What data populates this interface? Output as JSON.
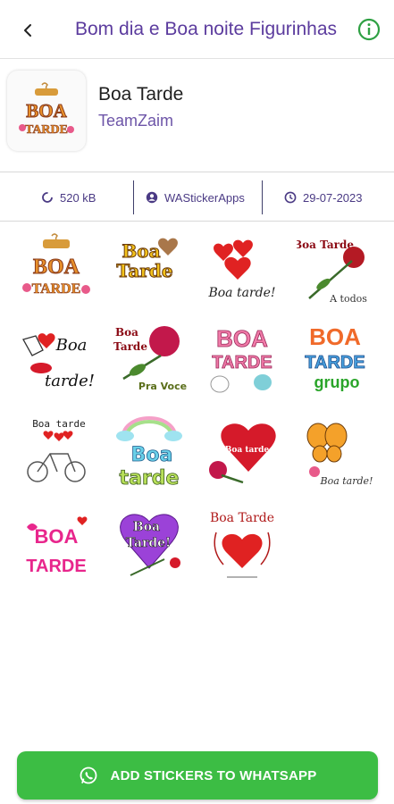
{
  "appbar": {
    "title": "Bom dia e Boa noite Figurinhas",
    "back_icon": "arrow-back-icon",
    "info_icon": "info-icon"
  },
  "pack": {
    "name": "Boa Tarde",
    "author": "TeamZaim",
    "thumb_text_top": "BOA",
    "thumb_text_bottom": "TARDE"
  },
  "meta": {
    "size": "520 kB",
    "publisher": "WAStickerApps",
    "date": "29-07-2023"
  },
  "stickers": [
    {
      "name": "sticker-boa-tarde-cup",
      "t1": "BOA",
      "t2": "TARDE"
    },
    {
      "name": "sticker-boa-tarde-heart",
      "t1": "Boa",
      "t2": "Tarde"
    },
    {
      "name": "sticker-hearts-boa-tarde",
      "t1": "Boa tarde!"
    },
    {
      "name": "sticker-boa-tarde-a-todos",
      "t1": "Boa Tarde",
      "t2": "A todos"
    },
    {
      "name": "sticker-boa-tarde-kiss",
      "t1": "Boa",
      "t2": "tarde!"
    },
    {
      "name": "sticker-boa-tarde-pra-voce",
      "t1": "Boa",
      "t2": "Tarde",
      "t3": "Pra Voce"
    },
    {
      "name": "sticker-boa-tarde-birds",
      "t1": "BOA",
      "t2": "TARDE"
    },
    {
      "name": "sticker-boa-tarde-grupo",
      "t1": "BOA",
      "t2": "TARDE",
      "t3": "grupo"
    },
    {
      "name": "sticker-boa-tarde-bicycle",
      "t1": "Boa tarde"
    },
    {
      "name": "sticker-boa-tarde-rainbow",
      "t1": "Boa",
      "t2": "tarde"
    },
    {
      "name": "sticker-boa-tarde-big-heart",
      "t1": "Boa tarde."
    },
    {
      "name": "sticker-boa-tarde-butterfly",
      "t1": "Boa tarde!"
    },
    {
      "name": "sticker-boa-tarde-pink",
      "t1": "BOA",
      "t2": "TARDE"
    },
    {
      "name": "sticker-boa-tarde-purple-heart",
      "t1": "Boa",
      "t2": "Tarde!"
    },
    {
      "name": "sticker-boa-tarde-heart-frame",
      "t1": "Boa Tarde"
    }
  ],
  "add_button": {
    "label": "ADD STICKERS TO WHATSAPP",
    "icon": "whatsapp-icon"
  },
  "colors": {
    "title": "#5c3c9e",
    "author": "#6d55a8",
    "button": "#3cbd44",
    "info": "#2ea043"
  }
}
